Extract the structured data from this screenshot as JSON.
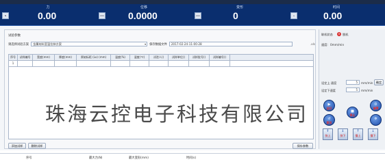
{
  "readouts": [
    {
      "label": "力",
      "value": "0.00",
      "unit": "N"
    },
    {
      "label": "位移",
      "value": "0.0000",
      "unit": "mm"
    },
    {
      "label": "变形",
      "value": "0",
      "unit": "mm"
    },
    {
      "label": "时间",
      "value": "0.00",
      "unit": "s"
    }
  ],
  "form": {
    "section_title": "试验参数",
    "scheme_label": "请选择试验方案",
    "scheme_value": "金属材料室温拉伸方案",
    "save_file_label": "保存数据文件",
    "save_file_value": "2017-02-24-11-00-28",
    "save_file_suffix": ".xls"
  },
  "table": {
    "headers": [
      "序号",
      "试样编号",
      "宽度(mm)",
      "厚度(mm)",
      "原始标距 (Lo) (mm)",
      "温度(%)",
      "湿度(℃)",
      "试验人()",
      "试样单位()",
      "试样批号()",
      "试样编号()"
    ],
    "rows": [
      [
        "1",
        "",
        "",
        "",
        "",
        "",
        "",
        "",
        "",
        "",
        ""
      ]
    ]
  },
  "watermark": "珠海云控电子科技有限公司",
  "buttons": {
    "add_sample": "添加试样",
    "delete_sample": "删除试样",
    "save_params": "保存参数"
  },
  "right_panel": {
    "status_label": "联机状态",
    "status_value": "脱机",
    "speed_label": "速度:",
    "speed_value": "0mm/min",
    "up_speed_label": "设定上 速度",
    "up_speed_value": "5",
    "up_speed_unit": "mm/min",
    "confirm_label": "确定",
    "down_speed_label": "设定下速度",
    "down_speed_value": "5",
    "down_speed_unit": "mm/min",
    "run_label": "运行",
    "stop_label": "停止",
    "clear_label": "清零",
    "reset_label": "复位",
    "up_label": "快上",
    "fast_down_label": "快下",
    "slow_up_label": "慢上",
    "slow_down_label": "慢下"
  },
  "footer": {
    "col1": "序号",
    "col2": "最大力(N)",
    "col3": "最大变形(mm)",
    "col4": "时间(s)"
  }
}
